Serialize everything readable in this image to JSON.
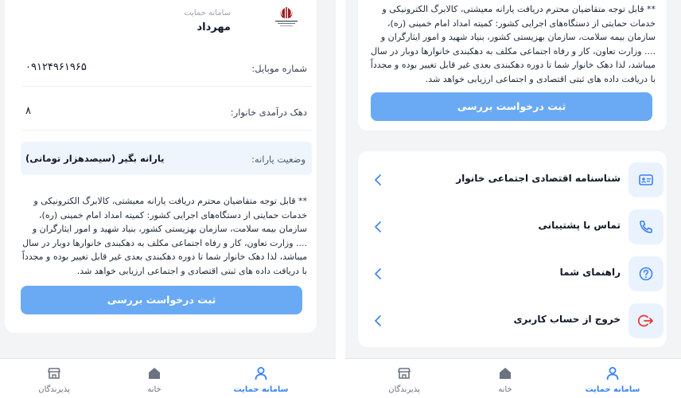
{
  "left": {
    "header": {
      "app_name": "سامانه حمایت",
      "user_name": "مهرداد"
    },
    "profile": {
      "mobile_label": "شماره موبایل:",
      "mobile_value": "۰۹۱۲۴۹۶۱۹۶۵",
      "decile_label": "دهک درآمدی خانوار:",
      "decile_value": "۸",
      "subsidy_label": "وضعیت یارانه:",
      "subsidy_value": "یارانه بگیر (سیصدهزار تومانی)"
    },
    "notice": {
      "text": "** قابل توجه متقاضیان محترم دریافت یارانه معیشتی، کالابرگ الکترونیکی و خدمات حمایتی از دستگاه‌های اجرایی کشور: کمیته امداد امام خمینی (ره)، سازمان بیمه سلامت، سازمان بهزیستی کشور، بنیاد شهید و امور ایثارگران و .... وزارت تعاون، کار و رفاه اجتماعی مکلف به دهکبندی خانوارها دوبار در سال میباشد، لذا دهک خانوار شما تا دوره دهکبندی بعدی غیر قابل تغییر بوده و مجدداً با دریافت داده های ثبتی اقتصادی و اجتماعی ارزیابی خواهد شد.",
      "button_label": "ثبت درخواست بررسی"
    }
  },
  "right": {
    "notice": {
      "text": "** قابل توجه متقاضیان محترم دریافت یارانه معیشتی، کالابرگ الکترونیکی و خدمات حمایتی از دستگاه‌های اجرایی کشور: کمیته امداد امام خمینی (ره)، سازمان بیمه سلامت، سازمان بهزیستی کشور، بنیاد شهید و امور ایثارگران و .... وزارت تعاون، کار و رفاه اجتماعی مکلف به دهکبندی خانوارها دوبار در سال میباشد، لذا دهک خانوار شما تا دوره دهکبندی بعدی غیر قابل تغییر بوده و مجدداً با دریافت داده های ثبتی اقتصادی و اجتماعی ارزیابی خواهد شد.",
      "button_label": "ثبت درخواست بررسی"
    },
    "menu": [
      {
        "label": "شناسنامه اقتصادی اجتماعی خانوار",
        "icon": "id-card-icon"
      },
      {
        "label": "تماس با پشتیبانی",
        "icon": "phone-icon"
      },
      {
        "label": "راهنمای شما",
        "icon": "help-icon"
      },
      {
        "label": "خروج از حساب کاربری",
        "icon": "logout-icon"
      }
    ]
  },
  "nav": {
    "items": [
      {
        "label": "پذیرندگان",
        "icon": "store-icon",
        "active": false
      },
      {
        "label": "خانه",
        "icon": "home-icon",
        "active": false
      },
      {
        "label": "سامانه حمایت",
        "icon": "user-icon",
        "active": true
      }
    ]
  },
  "colors": {
    "accent": "#3b82f6",
    "button": "#6aaaf5",
    "subsidy_bg": "#eef5fd",
    "logout_red": "#e53935"
  }
}
